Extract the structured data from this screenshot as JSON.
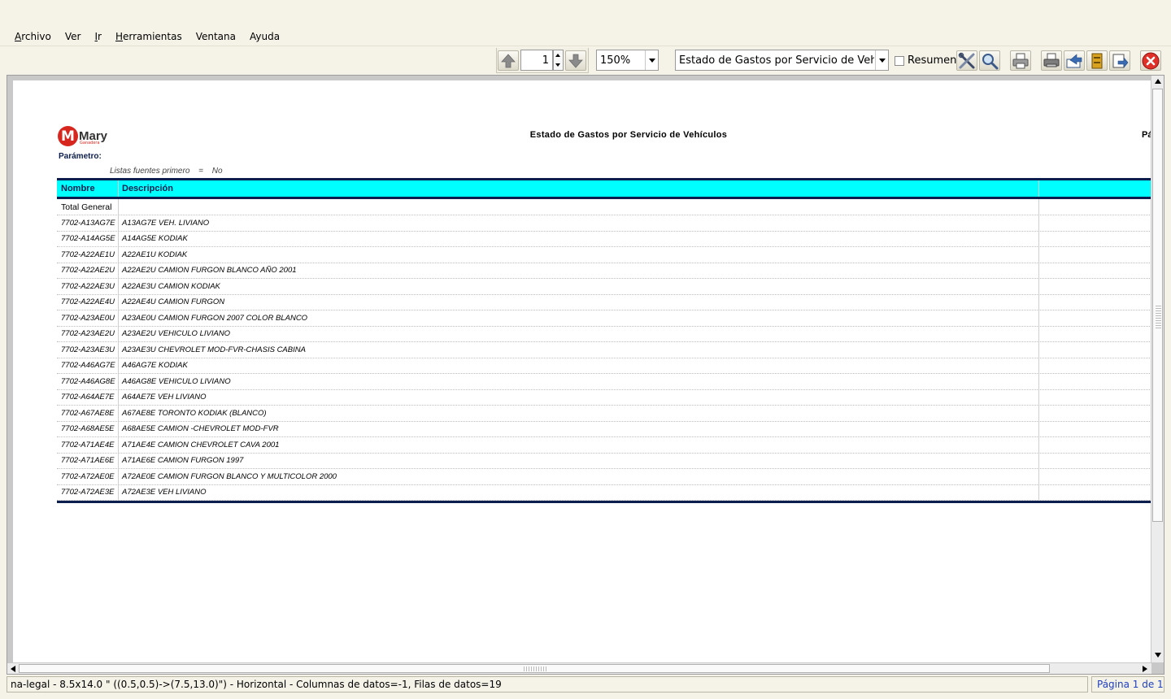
{
  "menu": [
    {
      "pre": "",
      "ul": "A",
      "post": "rchivo"
    },
    {
      "pre": "Ver",
      "ul": "",
      "post": ""
    },
    {
      "pre": "",
      "ul": "I",
      "post": "r"
    },
    {
      "pre": "",
      "ul": "H",
      "post": "erramientas"
    },
    {
      "pre": "Ventana",
      "ul": "",
      "post": ""
    },
    {
      "pre": "Ayuda",
      "ul": "",
      "post": ""
    }
  ],
  "toolbar": {
    "page_number": "1",
    "zoom": "150%",
    "report_selected": "Estado de Gastos por Servicio de Vehículos",
    "summary_label": "Resumen"
  },
  "report": {
    "logo_text": "Mary",
    "logo_sub": "Ganadera",
    "title": "Estado de Gastos por Servicio de Vehículos",
    "page_label": "Pá",
    "param_label": "Parámetro:",
    "param": {
      "name": "Listas fuentes primero",
      "op": "=",
      "value": "No"
    },
    "columns": {
      "name": "Nombre",
      "description": "Descripción"
    },
    "total_label": "Total General",
    "rows": [
      {
        "name": "7702-A13AG7E",
        "desc": "A13AG7E VEH. LIVIANO"
      },
      {
        "name": "7702-A14AG5E",
        "desc": "A14AG5E KODIAK"
      },
      {
        "name": "7702-A22AE1U",
        "desc": "A22AE1U KODIAK"
      },
      {
        "name": "7702-A22AE2U",
        "desc": "A22AE2U CAMION FURGON BLANCO AÑO 2001"
      },
      {
        "name": "7702-A22AE3U",
        "desc": "A22AE3U CAMION KODIAK"
      },
      {
        "name": "7702-A22AE4U",
        "desc": "A22AE4U CAMION FURGON"
      },
      {
        "name": "7702-A23AE0U",
        "desc": "A23AE0U CAMION FURGON 2007 COLOR BLANCO"
      },
      {
        "name": "7702-A23AE2U",
        "desc": "A23AE2U VEHICULO LIVIANO"
      },
      {
        "name": "7702-A23AE3U",
        "desc": "A23AE3U CHEVROLET MOD-FVR-CHASIS CABINA"
      },
      {
        "name": "7702-A46AG7E",
        "desc": "A46AG7E KODIAK"
      },
      {
        "name": "7702-A46AG8E",
        "desc": "A46AG8E VEHICULO LIVIANO"
      },
      {
        "name": "7702-A64AE7E",
        "desc": "A64AE7E VEH LIVIANO"
      },
      {
        "name": "7702-A67AE8E",
        "desc": "A67AE8E TORONTO  KODIAK (BLANCO)"
      },
      {
        "name": "7702-A68AE5E",
        "desc": "A68AE5E CAMION -CHEVROLET MOD-FVR"
      },
      {
        "name": "7702-A71AE4E",
        "desc": "A71AE4E CAMION CHEVROLET CAVA 2001"
      },
      {
        "name": "7702-A71AE6E",
        "desc": "A71AE6E CAMION FURGON 1997"
      },
      {
        "name": "7702-A72AE0E",
        "desc": "A72AE0E CAMION FURGON BLANCO Y MULTICOLOR 2000"
      },
      {
        "name": "7702-A72AE3E",
        "desc": "A72AE3E VEH LIVIANO"
      }
    ]
  },
  "status": {
    "info": "na-legal - 8.5x14.0 \" ((0.5,0.5)->(7.5,13.0)\") - Horizontal - Columnas de datos=-1, Filas de datos=19",
    "page": "Página 1 de 1"
  },
  "icons": {
    "first_page": "arrow-up-icon",
    "next_page": "arrow-down-icon",
    "customize": "tools-icon",
    "find": "magnifier-icon",
    "print": "printer-icon",
    "print_preview": "print-setup-icon",
    "send": "send-icon",
    "archive": "archive-icon",
    "export": "export-icon",
    "close": "close-icon"
  },
  "colors": {
    "header_bg": "#00ffff",
    "rule": "#0b1e4d",
    "logo_red": "#d7261e",
    "close_red": "#e0302a",
    "status_link": "#1f3fbf"
  }
}
